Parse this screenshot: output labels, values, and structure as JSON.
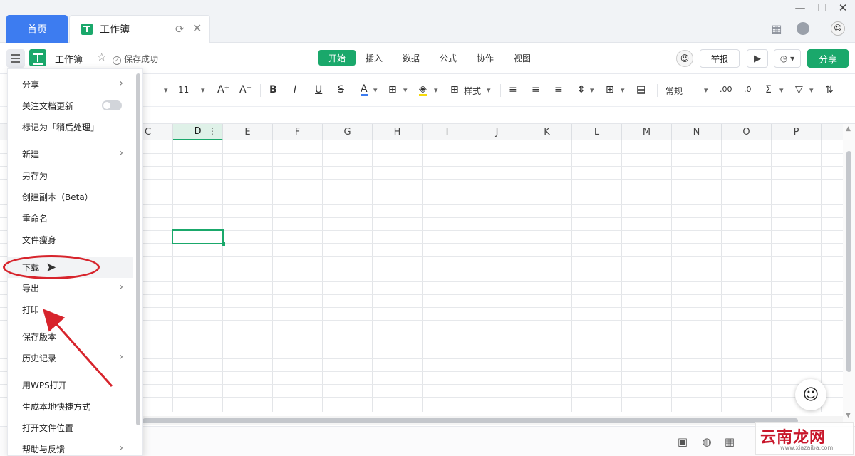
{
  "titlebar": {
    "home_tab": "首页",
    "doc_tab": "工作簿",
    "refresh_icon": "refresh-icon",
    "close_icon": "close-icon",
    "window_controls": [
      "minimize-icon",
      "maximize-icon",
      "close-window-icon"
    ],
    "right_icons": [
      "apps-grid-icon",
      "feedback-icon",
      "user-avatar"
    ]
  },
  "docbar": {
    "doc_name": "工作簿",
    "save_status": "保存成功",
    "tabs": [
      {
        "label": "开始",
        "active": true
      },
      {
        "label": "插入",
        "active": false
      },
      {
        "label": "数据",
        "active": false
      },
      {
        "label": "公式",
        "active": false
      },
      {
        "label": "协作",
        "active": false
      },
      {
        "label": "视图",
        "active": false
      }
    ],
    "report_label": "举报",
    "share_label": "分享"
  },
  "toolbar": {
    "font_size": "11",
    "style_label": "样式",
    "number_format": "常规",
    "text_color": "#3d7cf0",
    "fill_color": "#f5d90a"
  },
  "grid": {
    "columns": [
      "C",
      "D",
      "E",
      "F",
      "G",
      "H",
      "I",
      "J",
      "K",
      "L",
      "M",
      "N",
      "O",
      "P"
    ],
    "selected_column": "D"
  },
  "menu": {
    "items": [
      {
        "label": "分享",
        "arrow": true
      },
      {
        "label": "关注文档更新",
        "toggle": true
      },
      {
        "label": "标记为「稍后处理」"
      },
      {
        "label": "新建",
        "arrow": true
      },
      {
        "label": "另存为"
      },
      {
        "label": "创建副本（Beta）"
      },
      {
        "label": "重命名"
      },
      {
        "label": "文件瘦身"
      },
      {
        "label": "下载",
        "hover": true
      },
      {
        "label": "导出",
        "arrow": true
      },
      {
        "label": "打印"
      },
      {
        "label": "保存版本"
      },
      {
        "label": "历史记录",
        "arrow": true
      },
      {
        "label": "用WPS打开"
      },
      {
        "label": "生成本地快捷方式"
      },
      {
        "label": "打开文件位置"
      },
      {
        "label": "帮助与反馈",
        "arrow": true
      }
    ]
  },
  "watermark": {
    "main": "云南龙网",
    "sub": "www.xiazaiba.com"
  },
  "colors": {
    "brand_green": "#1aa86b",
    "home_blue": "#3d7cf0",
    "annotation_red": "#d7242c"
  }
}
